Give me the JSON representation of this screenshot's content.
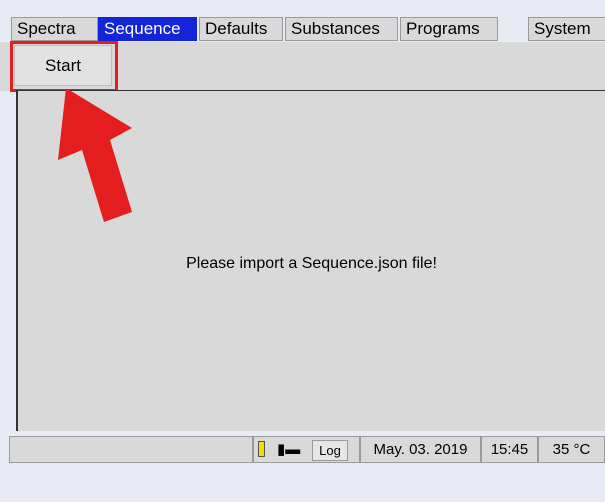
{
  "tabs": [
    {
      "label": "Spectra",
      "active": false
    },
    {
      "label": "Sequence",
      "active": true
    },
    {
      "label": "Defaults",
      "active": false
    },
    {
      "label": "Substances",
      "active": false
    },
    {
      "label": "Programs",
      "active": false
    },
    {
      "label": "System",
      "active": false
    }
  ],
  "toolbar": {
    "start_label": "Start"
  },
  "main": {
    "message": "Please import a Sequence.json file!"
  },
  "annotation": {
    "color": "#e41e1e"
  },
  "statusbar": {
    "battery_icon": "battery-icon",
    "plug_icon": "plug-icon",
    "plug_glyph": "▮▬",
    "log_label": "Log",
    "date": "May. 03. 2019",
    "time": "15:45",
    "temperature": "35 °C"
  },
  "colors": {
    "active_tab": "#1424d8",
    "background": "#d9d9d9",
    "page": "#e8eaf4"
  }
}
